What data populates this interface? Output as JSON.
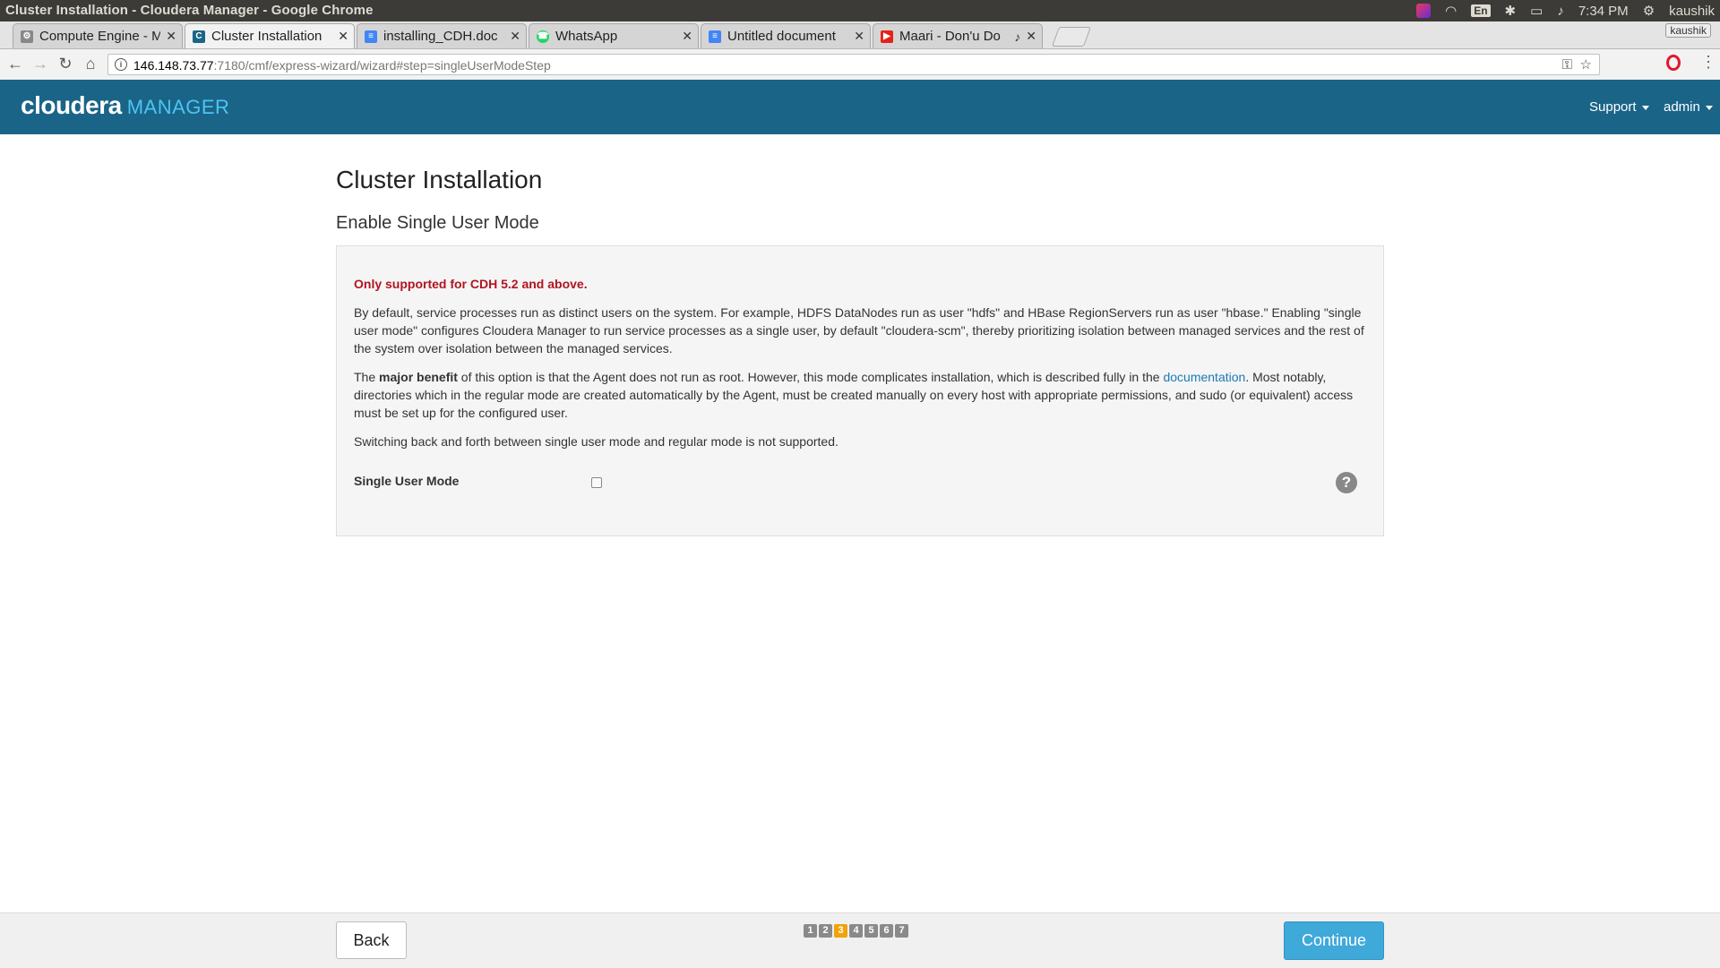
{
  "os": {
    "window_title": "Cluster Installation - Cloudera Manager - Google Chrome",
    "tray": {
      "keyboard": "En",
      "time": "7:34 PM",
      "user": "kaushik"
    },
    "icons": [
      "hexagon-app-icon",
      "wifi-icon",
      "bluetooth-icon",
      "battery-icon",
      "volume-icon",
      "settings-gear-icon"
    ]
  },
  "browser": {
    "tabs": [
      {
        "title": "Compute Engine - M",
        "favicon": "gear-icon",
        "color": "#888888",
        "active": false
      },
      {
        "title": "Cluster Installation",
        "favicon": "cloudera-c-icon",
        "color": "#1a6488",
        "active": true
      },
      {
        "title": "installing_CDH.doc",
        "favicon": "docs-icon",
        "color": "#4285f4",
        "active": false
      },
      {
        "title": "WhatsApp",
        "favicon": "whatsapp-icon",
        "color": "#25d366",
        "active": false
      },
      {
        "title": "Untitled document",
        "favicon": "docs-icon",
        "color": "#4285f4",
        "active": false
      },
      {
        "title": "Maari - Don'u Do",
        "favicon": "youtube-icon",
        "color": "#e62117",
        "active": false
      }
    ],
    "profile_name": "kaushik",
    "url_host": "146.148.73.77",
    "url_path": ":7180/cmf/express-wizard/wizard#step=singleUserModeStep"
  },
  "header": {
    "logo_main": "cloudera",
    "logo_sub": "MANAGER",
    "support_label": "Support",
    "user_label": "admin",
    "color": "#1a6488"
  },
  "page": {
    "title": "Cluster Installation",
    "subtitle": "Enable Single User Mode",
    "warning": "Only supported for CDH 5.2 and above.",
    "para1": "By default, service processes run as distinct users on the system. For example, HDFS DataNodes run as user \"hdfs\" and HBase RegionServers run as user \"hbase.\" Enabling \"single user mode\" configures Cloudera Manager to run service processes as a single user, by default \"cloudera-scm\", thereby prioritizing isolation between managed services and the rest of the system over isolation between the managed services.",
    "para2_pre": "The ",
    "para2_bold": "major benefit",
    "para2_mid": " of this option is that the Agent does not run as root. However, this mode complicates installation, which is described fully in the ",
    "para2_link": "documentation",
    "para2_post": ". Most notably, directories which in the regular mode are created automatically by the Agent, must be created manually on every host with appropriate permissions, and sudo (or equivalent) access must be set up for the configured user.",
    "para3": "Switching back and forth between single user mode and regular mode is not supported.",
    "option_label": "Single User Mode",
    "option_checked": false,
    "help_glyph": "?"
  },
  "footer": {
    "back_label": "Back",
    "continue_label": "Continue",
    "steps": [
      "1",
      "2",
      "3",
      "4",
      "5",
      "6",
      "7"
    ],
    "current_step": 3
  }
}
